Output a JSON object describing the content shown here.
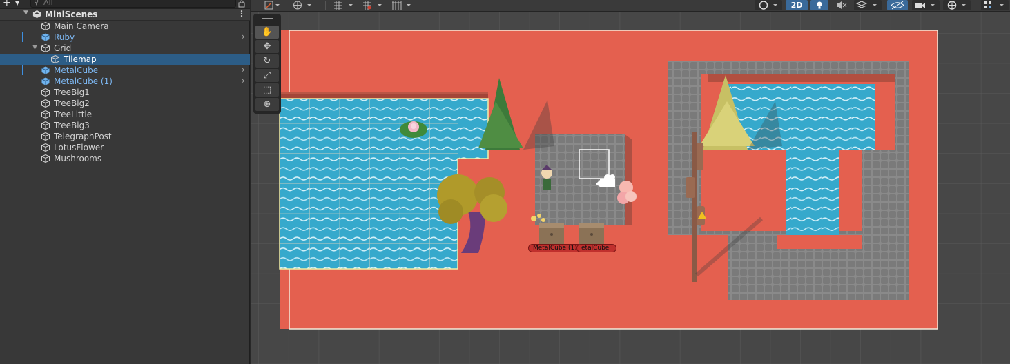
{
  "hierarchy": {
    "search_placeholder": "All",
    "scene_name": "MiniScenes",
    "items": [
      {
        "label": "Main Camera",
        "indent": 0
      },
      {
        "label": "Ruby",
        "indent": 0
      },
      {
        "label": "Grid",
        "indent": 0
      },
      {
        "label": "Tilemap",
        "indent": 1
      },
      {
        "label": "MetalCube",
        "indent": 0
      },
      {
        "label": "MetalCube (1)",
        "indent": 0
      },
      {
        "label": "TreeBig1",
        "indent": 0
      },
      {
        "label": "TreeBig2",
        "indent": 0
      },
      {
        "label": "TreeLittle",
        "indent": 0
      },
      {
        "label": "TreeBig3",
        "indent": 0
      },
      {
        "label": "TelegraphPost",
        "indent": 0
      },
      {
        "label": "LotusFlower",
        "indent": 0
      },
      {
        "label": "Mushrooms",
        "indent": 0
      }
    ]
  },
  "scene_toolbar": {
    "mode_2d": "2D"
  },
  "tools": [
    "hand-tool",
    "move-tool",
    "rotate-tool",
    "scale-tool",
    "rect-tool",
    "transform-tool"
  ],
  "scene_labels": {
    "metal_cube_1": "MetalCube (1)",
    "metal_cube": "etalCube"
  },
  "colors": {
    "ground": "#e4604f",
    "water": "#3aaed0",
    "stone": "#7e7e7e",
    "selection": "#2c5d87",
    "prefab_text": "#7cb6f0"
  }
}
